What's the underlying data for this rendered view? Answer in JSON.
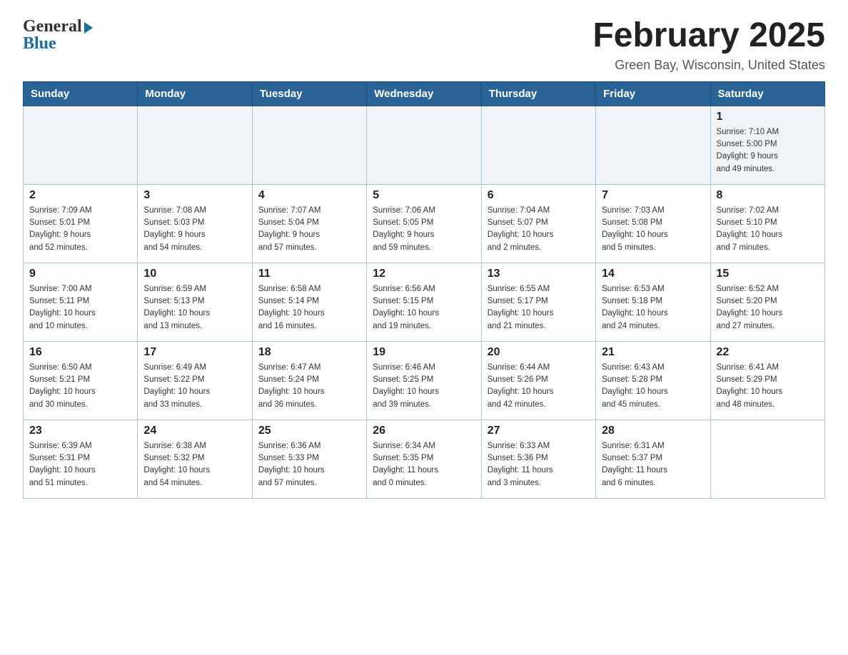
{
  "header": {
    "title": "February 2025",
    "location": "Green Bay, Wisconsin, United States",
    "logo_general": "General",
    "logo_blue": "Blue"
  },
  "weekdays": [
    "Sunday",
    "Monday",
    "Tuesday",
    "Wednesday",
    "Thursday",
    "Friday",
    "Saturday"
  ],
  "weeks": [
    [
      {
        "day": "",
        "info": ""
      },
      {
        "day": "",
        "info": ""
      },
      {
        "day": "",
        "info": ""
      },
      {
        "day": "",
        "info": ""
      },
      {
        "day": "",
        "info": ""
      },
      {
        "day": "",
        "info": ""
      },
      {
        "day": "1",
        "info": "Sunrise: 7:10 AM\nSunset: 5:00 PM\nDaylight: 9 hours\nand 49 minutes."
      }
    ],
    [
      {
        "day": "2",
        "info": "Sunrise: 7:09 AM\nSunset: 5:01 PM\nDaylight: 9 hours\nand 52 minutes."
      },
      {
        "day": "3",
        "info": "Sunrise: 7:08 AM\nSunset: 5:03 PM\nDaylight: 9 hours\nand 54 minutes."
      },
      {
        "day": "4",
        "info": "Sunrise: 7:07 AM\nSunset: 5:04 PM\nDaylight: 9 hours\nand 57 minutes."
      },
      {
        "day": "5",
        "info": "Sunrise: 7:06 AM\nSunset: 5:05 PM\nDaylight: 9 hours\nand 59 minutes."
      },
      {
        "day": "6",
        "info": "Sunrise: 7:04 AM\nSunset: 5:07 PM\nDaylight: 10 hours\nand 2 minutes."
      },
      {
        "day": "7",
        "info": "Sunrise: 7:03 AM\nSunset: 5:08 PM\nDaylight: 10 hours\nand 5 minutes."
      },
      {
        "day": "8",
        "info": "Sunrise: 7:02 AM\nSunset: 5:10 PM\nDaylight: 10 hours\nand 7 minutes."
      }
    ],
    [
      {
        "day": "9",
        "info": "Sunrise: 7:00 AM\nSunset: 5:11 PM\nDaylight: 10 hours\nand 10 minutes."
      },
      {
        "day": "10",
        "info": "Sunrise: 6:59 AM\nSunset: 5:13 PM\nDaylight: 10 hours\nand 13 minutes."
      },
      {
        "day": "11",
        "info": "Sunrise: 6:58 AM\nSunset: 5:14 PM\nDaylight: 10 hours\nand 16 minutes."
      },
      {
        "day": "12",
        "info": "Sunrise: 6:56 AM\nSunset: 5:15 PM\nDaylight: 10 hours\nand 19 minutes."
      },
      {
        "day": "13",
        "info": "Sunrise: 6:55 AM\nSunset: 5:17 PM\nDaylight: 10 hours\nand 21 minutes."
      },
      {
        "day": "14",
        "info": "Sunrise: 6:53 AM\nSunset: 5:18 PM\nDaylight: 10 hours\nand 24 minutes."
      },
      {
        "day": "15",
        "info": "Sunrise: 6:52 AM\nSunset: 5:20 PM\nDaylight: 10 hours\nand 27 minutes."
      }
    ],
    [
      {
        "day": "16",
        "info": "Sunrise: 6:50 AM\nSunset: 5:21 PM\nDaylight: 10 hours\nand 30 minutes."
      },
      {
        "day": "17",
        "info": "Sunrise: 6:49 AM\nSunset: 5:22 PM\nDaylight: 10 hours\nand 33 minutes."
      },
      {
        "day": "18",
        "info": "Sunrise: 6:47 AM\nSunset: 5:24 PM\nDaylight: 10 hours\nand 36 minutes."
      },
      {
        "day": "19",
        "info": "Sunrise: 6:46 AM\nSunset: 5:25 PM\nDaylight: 10 hours\nand 39 minutes."
      },
      {
        "day": "20",
        "info": "Sunrise: 6:44 AM\nSunset: 5:26 PM\nDaylight: 10 hours\nand 42 minutes."
      },
      {
        "day": "21",
        "info": "Sunrise: 6:43 AM\nSunset: 5:28 PM\nDaylight: 10 hours\nand 45 minutes."
      },
      {
        "day": "22",
        "info": "Sunrise: 6:41 AM\nSunset: 5:29 PM\nDaylight: 10 hours\nand 48 minutes."
      }
    ],
    [
      {
        "day": "23",
        "info": "Sunrise: 6:39 AM\nSunset: 5:31 PM\nDaylight: 10 hours\nand 51 minutes."
      },
      {
        "day": "24",
        "info": "Sunrise: 6:38 AM\nSunset: 5:32 PM\nDaylight: 10 hours\nand 54 minutes."
      },
      {
        "day": "25",
        "info": "Sunrise: 6:36 AM\nSunset: 5:33 PM\nDaylight: 10 hours\nand 57 minutes."
      },
      {
        "day": "26",
        "info": "Sunrise: 6:34 AM\nSunset: 5:35 PM\nDaylight: 11 hours\nand 0 minutes."
      },
      {
        "day": "27",
        "info": "Sunrise: 6:33 AM\nSunset: 5:36 PM\nDaylight: 11 hours\nand 3 minutes."
      },
      {
        "day": "28",
        "info": "Sunrise: 6:31 AM\nSunset: 5:37 PM\nDaylight: 11 hours\nand 6 minutes."
      },
      {
        "day": "",
        "info": ""
      }
    ]
  ]
}
